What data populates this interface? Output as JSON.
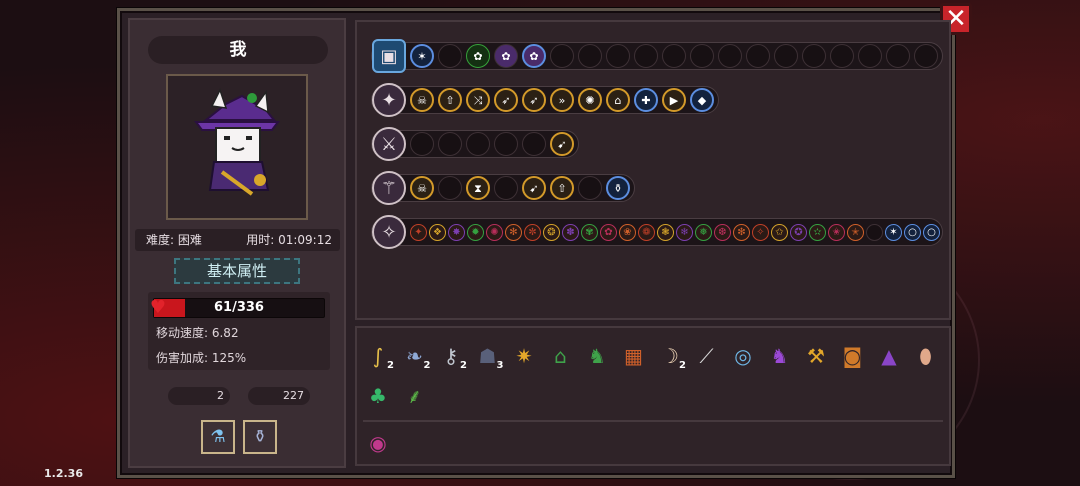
{
  "player": {
    "name": "我",
    "difficulty": "难度: 困难",
    "time": "用时: 01:09:12",
    "section_title": "基本属性",
    "hp": "61/336",
    "hp_fraction": 0.18,
    "move_speed": "移动速度: 6.82",
    "damage_bonus": "伤害加成: 125%",
    "keys": "2",
    "coins": "227"
  },
  "version": "1.2.36",
  "weapon_rows": [
    {
      "weapon_icon": "treasure-chest-icon",
      "slots": [
        "star-icon",
        "empty",
        "green-orb-icon",
        "purple-orb-icon",
        "purple-orb-icon",
        "empty",
        "empty",
        "empty",
        "empty",
        "empty",
        "empty",
        "empty",
        "empty",
        "empty",
        "empty",
        "empty",
        "empty",
        "empty",
        "empty"
      ]
    },
    {
      "weapon_icon": "magic-staff-icon",
      "slots": [
        "skull-icon",
        "up-arrow-icon",
        "triple-arrow-icon",
        "bow-icon",
        "bow-icon",
        "double-chevron-icon",
        "flame-icon",
        "hat-icon",
        "crossbow-icon",
        "play-icon",
        "gem-icon"
      ]
    },
    {
      "weapon_icon": "dark-blade-icon",
      "slots": [
        "empty",
        "empty",
        "empty",
        "empty",
        "empty",
        "flame-arrow-icon"
      ]
    },
    {
      "weapon_icon": "fire-staff-icon",
      "slots": [
        "skull-icon",
        "empty",
        "hourglass-icon",
        "empty",
        "flame-arrow-icon",
        "up-arrow-icon",
        "empty",
        "potion-icon"
      ]
    },
    {
      "weapon_icon": "purple-staff-icon",
      "slots": [
        "rune-01",
        "rune-02",
        "rune-03",
        "rune-04",
        "rune-05",
        "rune-06",
        "rune-07",
        "rune-08",
        "rune-09",
        "rune-10",
        "rune-11",
        "rune-12",
        "rune-13",
        "rune-14",
        "rune-15",
        "rune-16",
        "rune-17",
        "rune-18",
        "rune-19",
        "rune-20",
        "rune-21",
        "rune-22",
        "rune-23",
        "rune-24",
        "empty",
        "star-icon",
        "bubble-icon",
        "bubble-icon"
      ]
    }
  ],
  "items": [
    {
      "icon": "hook-icon",
      "count": "2"
    },
    {
      "icon": "feather-icon",
      "count": "2"
    },
    {
      "icon": "key-icon",
      "count": "2"
    },
    {
      "icon": "cloak-icon",
      "count": "3"
    },
    {
      "icon": "crystal-icon",
      "count": ""
    },
    {
      "icon": "hat-green-icon",
      "count": ""
    },
    {
      "icon": "boot-green-icon",
      "count": ""
    },
    {
      "icon": "map-icon",
      "count": ""
    },
    {
      "icon": "claw-icon",
      "count": "2"
    },
    {
      "icon": "wand-icon",
      "count": ""
    },
    {
      "icon": "ring-icon",
      "count": ""
    },
    {
      "icon": "boot-purple-icon",
      "count": ""
    },
    {
      "icon": "hammer-icon",
      "count": ""
    },
    {
      "icon": "barrel-icon",
      "count": ""
    },
    {
      "icon": "wizard-hat-icon",
      "count": ""
    },
    {
      "icon": "egg-icon",
      "count": ""
    },
    {
      "icon": "clover-icon",
      "count": ""
    },
    {
      "icon": "sprout-icon",
      "count": ""
    }
  ],
  "special_items": [
    {
      "icon": "swirl-orb-icon"
    }
  ],
  "colors": {
    "hp": "#c9161d",
    "close": "#c8242a",
    "panel": "#2f2328",
    "accent": "#d39a2a"
  }
}
